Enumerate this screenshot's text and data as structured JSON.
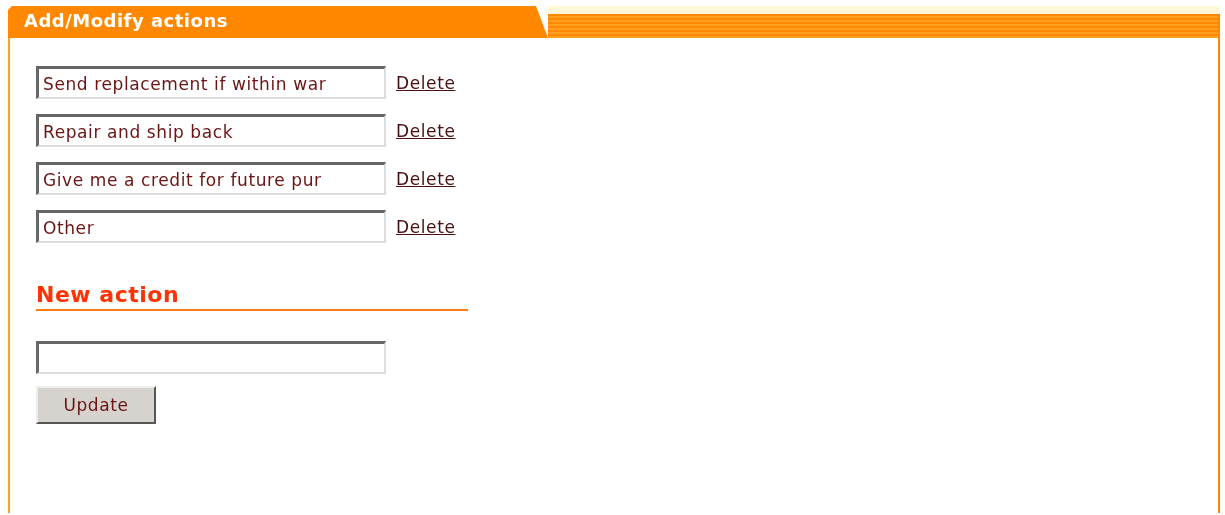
{
  "panel": {
    "title": "Add/Modify actions"
  },
  "actions": [
    {
      "value": "Send replacement if within war",
      "delete": "Delete"
    },
    {
      "value": "Repair and ship back",
      "delete": "Delete"
    },
    {
      "value": "Give me a credit for future pur",
      "delete": "Delete"
    },
    {
      "value": "Other",
      "delete": "Delete"
    }
  ],
  "new_action": {
    "heading": "New action",
    "button": "Update"
  }
}
